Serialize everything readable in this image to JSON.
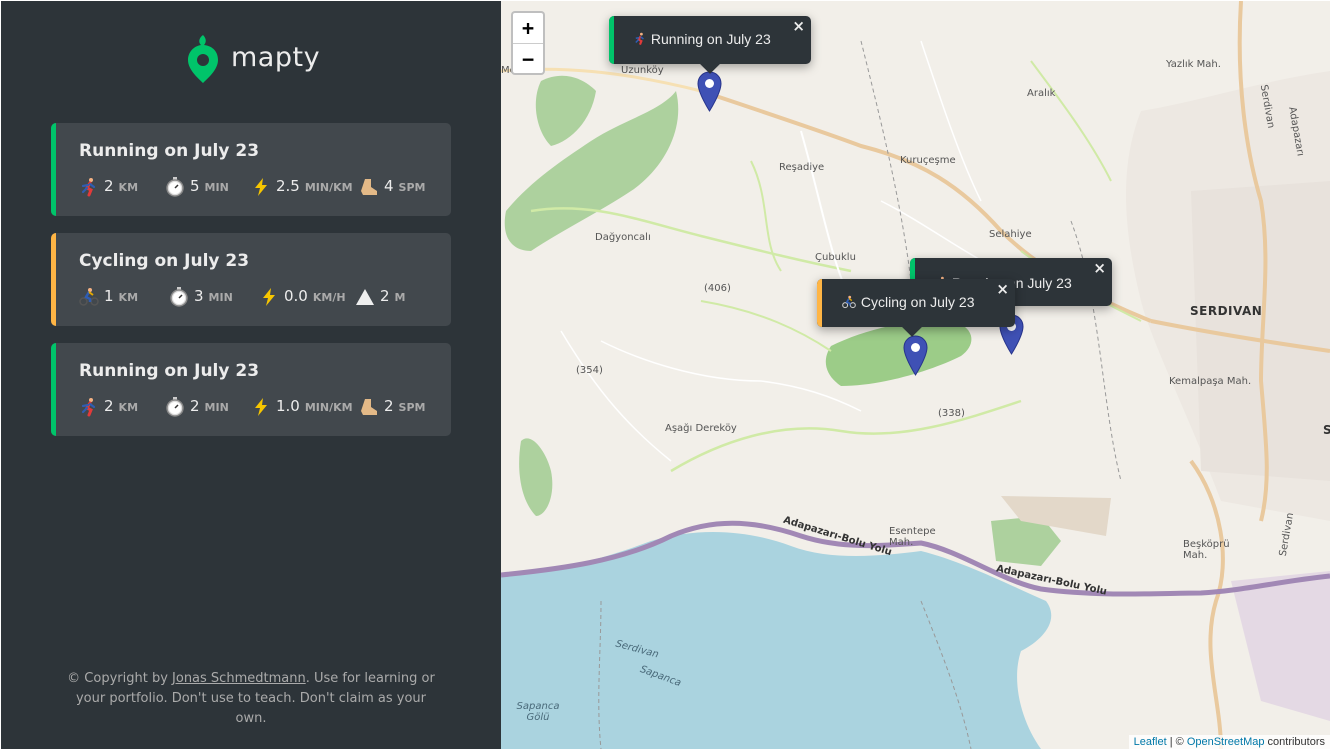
{
  "app": {
    "name": "mapty"
  },
  "colors": {
    "running": "#00c46a",
    "cycling": "#ffb545",
    "sidebar_bg": "#2d3439",
    "card_bg": "#42484d",
    "marker": "#3f51b5"
  },
  "workouts": [
    {
      "type": "running",
      "title": "Running on July 23",
      "details": [
        {
          "icon": "runner-icon",
          "value": "2",
          "unit": "km"
        },
        {
          "icon": "stopwatch-icon",
          "value": "5",
          "unit": "min"
        },
        {
          "icon": "lightning-icon",
          "value": "2.5",
          "unit": "min/km"
        },
        {
          "icon": "footprint-icon",
          "value": "4",
          "unit": "spm"
        }
      ]
    },
    {
      "type": "cycling",
      "title": "Cycling on July 23",
      "details": [
        {
          "icon": "cyclist-icon",
          "value": "1",
          "unit": "km"
        },
        {
          "icon": "stopwatch-icon",
          "value": "3",
          "unit": "min"
        },
        {
          "icon": "lightning-icon",
          "value": "0.0",
          "unit": "km/h"
        },
        {
          "icon": "mountain-icon",
          "value": "2",
          "unit": "m"
        }
      ]
    },
    {
      "type": "running",
      "title": "Running on July 23",
      "details": [
        {
          "icon": "runner-icon",
          "value": "2",
          "unit": "km"
        },
        {
          "icon": "stopwatch-icon",
          "value": "2",
          "unit": "min"
        },
        {
          "icon": "lightning-icon",
          "value": "1.0",
          "unit": "min/km"
        },
        {
          "icon": "footprint-icon",
          "value": "2",
          "unit": "spm"
        }
      ]
    }
  ],
  "copyright": {
    "prefix": "© Copyright by ",
    "author": "Jonas Schmedtmann",
    "suffix": ". Use for learning or your portfolio. Don't use to teach. Don't claim as your own."
  },
  "map": {
    "zoom_in": "+",
    "zoom_out": "−",
    "popups": [
      {
        "type": "running",
        "text": "Running on July 23",
        "close": "×"
      },
      {
        "type": "running",
        "text": "Running on July 23",
        "close": "×"
      },
      {
        "type": "cycling",
        "text": "Cycling on July 23",
        "close": "×"
      }
    ],
    "labels": {
      "uzunkoy": "Uzunköy",
      "mese": "Meşe",
      "yazlik": "Yazlık Mah.",
      "aralik": "Aralık",
      "resadiye": "Reşadiye",
      "kurucesme": "Kuruçeşme",
      "dagyoncali": "Dağyoncalı",
      "selahiye": "Selahiye",
      "cubuklu": "Çubuklu",
      "h406": "(406)",
      "h354": "(354)",
      "h338": "(338)",
      "serdivan": "SERDIVAN",
      "kemalpasa": "Kemalpaşa Mah.",
      "asagi_derekoy": "Aşağı Dereköy",
      "esentepe": "Esentepe Mah.",
      "road1": "Adapazarı-Bolu Yolu",
      "road2": "Adapazarı-Bolu Yolu",
      "beskopru": "Beşköprü Mah.",
      "serdivan_lake": "Serdivan",
      "sapanca": "Sapanca",
      "sapanca_golu": "Sapanca Gölü",
      "serdivan_road_top": "Serdivan",
      "adapazari_road": "Adapazarı",
      "serdivan_road_bottom": "Serdivan",
      "edge_s": "S"
    },
    "attribution": {
      "leaflet": "Leaflet",
      "sep": " | © ",
      "osm": "OpenStreetMap",
      "contributors": " contributors"
    }
  }
}
